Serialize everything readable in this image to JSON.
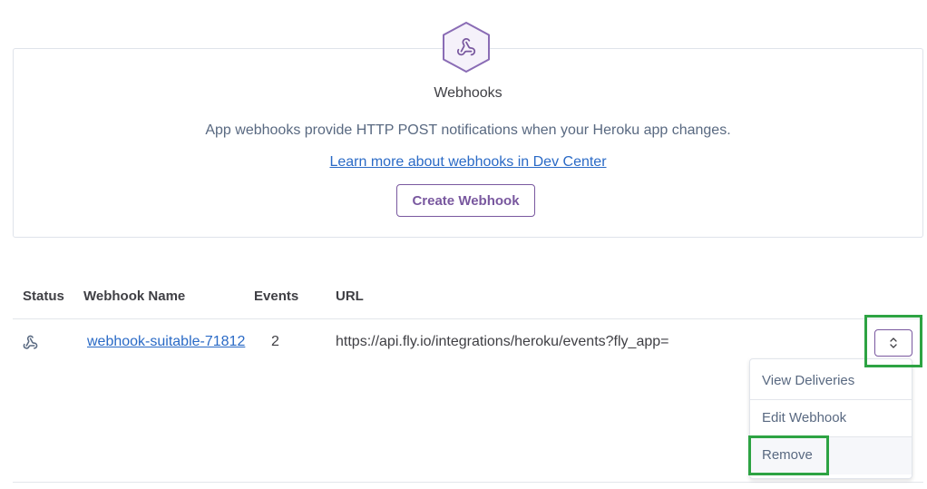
{
  "hero": {
    "icon": "webhook-icon",
    "title": "Webhooks",
    "description": "App webhooks provide HTTP POST notifications when your Heroku app changes.",
    "learn_more_link": "Learn more about webhooks in Dev Center",
    "create_button": "Create Webhook"
  },
  "table": {
    "headers": {
      "status": "Status",
      "name": "Webhook Name",
      "events": "Events",
      "url": "URL"
    },
    "rows": [
      {
        "status_icon": "webhook-icon",
        "name": "webhook-suitable-71812",
        "events": "2",
        "url": "https://api.fly.io/integrations/heroku/events?fly_app="
      }
    ]
  },
  "actions_menu": {
    "toggle_icon": "chevron-up-down-icon",
    "items": [
      "View Deliveries",
      "Edit Webhook",
      "Remove"
    ]
  },
  "colors": {
    "brand_purple": "#79589f",
    "link_blue": "#2a6ac6",
    "text": "#3f3f44",
    "muted_text": "#596981",
    "highlight_green": "#2da343"
  }
}
